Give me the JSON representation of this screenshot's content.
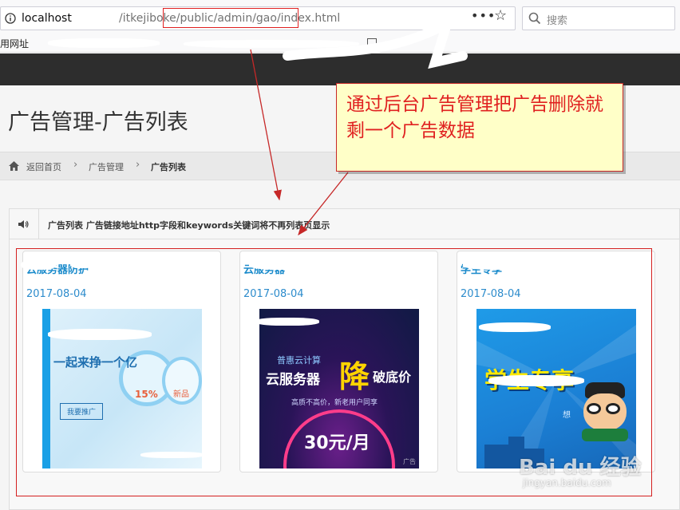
{
  "browser": {
    "url_host": "localhost",
    "url_path": "/itkejiboke/public/admin/gao/index.html",
    "search_placeholder": "搜索",
    "more_icon": "more-horizontal-icon",
    "star_icon": "bookmark-star-icon",
    "bookmark_text": "用网址"
  },
  "page": {
    "title": "广告管理-广告列表"
  },
  "breadcrumb": {
    "home_label": "返回首页",
    "section_label": "广告管理",
    "current_label": "广告列表",
    "separator": "›"
  },
  "panel": {
    "title": "广告列表 广告链接地址http字段和keywords关键词将不再列表页显示"
  },
  "cards": [
    {
      "title": "云服务器防护",
      "date": "2017-08-04",
      "image_text": {
        "line1": "一起来挣一个亿",
        "badge1": "15%",
        "badge2": "新品",
        "button": "我要推广"
      }
    },
    {
      "title": "云服务器",
      "date": "2017-08-04",
      "image_text": {
        "brand": "普惠云计算",
        "big1": "云服务器",
        "big2": "降",
        "big3": "破底价",
        "sub": "高质不高价，新老用户同享",
        "price": "30元/月",
        "corner": "广告"
      }
    },
    {
      "title": "学生专享",
      "date": "2017-08-04",
      "image_text": {
        "big": "学生专享",
        "badge": "想"
      }
    }
  ],
  "annotation": {
    "callout_text": "通过后台广告管理把广告删除就剩一个广告数据",
    "watermark": "Bai du 经验",
    "watermark_sub": "jingyan.baidu.com"
  },
  "colors": {
    "accent_red": "#e02020",
    "link_blue": "#1b8bcb",
    "topbar": "#2d2d2d"
  }
}
